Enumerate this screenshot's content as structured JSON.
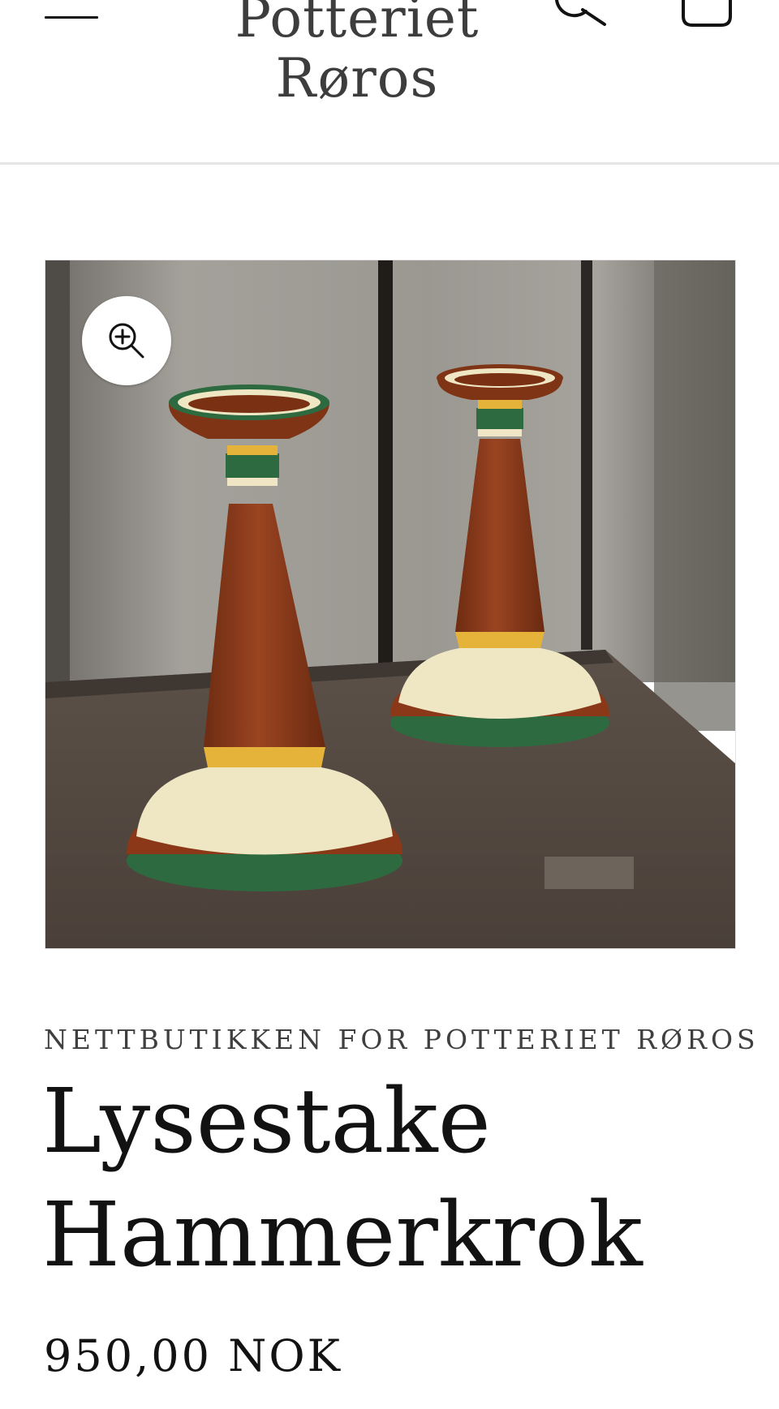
{
  "header": {
    "logo_line1": "Potteriet",
    "logo_line2": "Røros",
    "icons": {
      "menu": "hamburger-menu-icon",
      "search": "search-icon",
      "cart": "cart-icon"
    }
  },
  "product": {
    "image_alt": "Lysestake Hammerkrok",
    "zoom_icon": "zoom-in-icon",
    "vendor": "NETTBUTIKKEN FOR POTTERIET RØROS",
    "title": "Lysestake Hammerkrok",
    "price": "950,00 NOK"
  },
  "colors": {
    "text": "#121212",
    "logo": "#3d3d3d",
    "divider": "#e6e6e6",
    "terracotta": "#8f3c1c",
    "glaze_green": "#2e6a3f",
    "glaze_yellow": "#e6b33a",
    "cream": "#efe6c4"
  }
}
